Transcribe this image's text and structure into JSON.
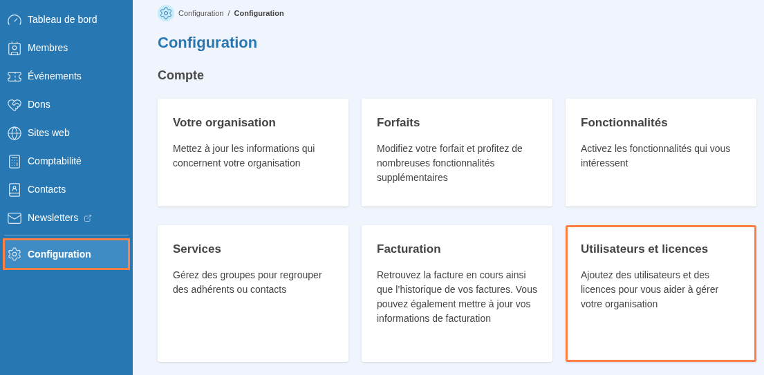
{
  "sidebar": {
    "items": [
      {
        "kind": "gauge",
        "label": "Tableau de bord",
        "selected": false,
        "highlighted": false,
        "external": false
      },
      {
        "kind": "members",
        "label": "Membres",
        "selected": false,
        "highlighted": false,
        "external": false
      },
      {
        "kind": "events",
        "label": "Événements",
        "selected": false,
        "highlighted": false,
        "external": false
      },
      {
        "kind": "donations",
        "label": "Dons",
        "selected": false,
        "highlighted": false,
        "external": false
      },
      {
        "kind": "websites",
        "label": "Sites web",
        "selected": false,
        "highlighted": false,
        "external": false
      },
      {
        "kind": "accounting",
        "label": "Comptabilité",
        "selected": false,
        "highlighted": false,
        "external": false
      },
      {
        "kind": "contacts",
        "label": "Contacts",
        "selected": false,
        "highlighted": false,
        "external": false
      },
      {
        "kind": "newsletters",
        "label": "Newsletters",
        "selected": false,
        "highlighted": false,
        "external": true
      },
      {
        "kind": "settings",
        "label": "Configuration",
        "selected": true,
        "highlighted": true,
        "external": false
      }
    ]
  },
  "breadcrumb": [
    "Configuration",
    "Configuration"
  ],
  "breadcrumb_separator": "/",
  "title": "Configuration",
  "section": "Compte",
  "cards": [
    {
      "title": "Votre organisation",
      "description": "Mettez à jour les informations qui concernent votre organisation",
      "highlighted": false
    },
    {
      "title": "Forfaits",
      "description": "Modifiez votre forfait et profitez de nombreuses fonctionnalités supplémentaires",
      "highlighted": false
    },
    {
      "title": "Fonctionnalités",
      "description": "Activez les fonctionnalités qui vous intéressent",
      "highlighted": false
    },
    {
      "title": "Services",
      "description": "Gérez des groupes pour regrouper des adhérents ou contacts",
      "highlighted": false
    },
    {
      "title": "Facturation",
      "description": "Retrouvez la facture en cours ainsi que l’historique de vos factures. Vous pouvez également mettre à jour vos informations de facturation",
      "highlighted": false
    },
    {
      "title": "Utilisateurs et licences",
      "description": "Ajoutez des utilisateurs et des licences pour vous aider à gérer votre organisation",
      "highlighted": true
    }
  ]
}
